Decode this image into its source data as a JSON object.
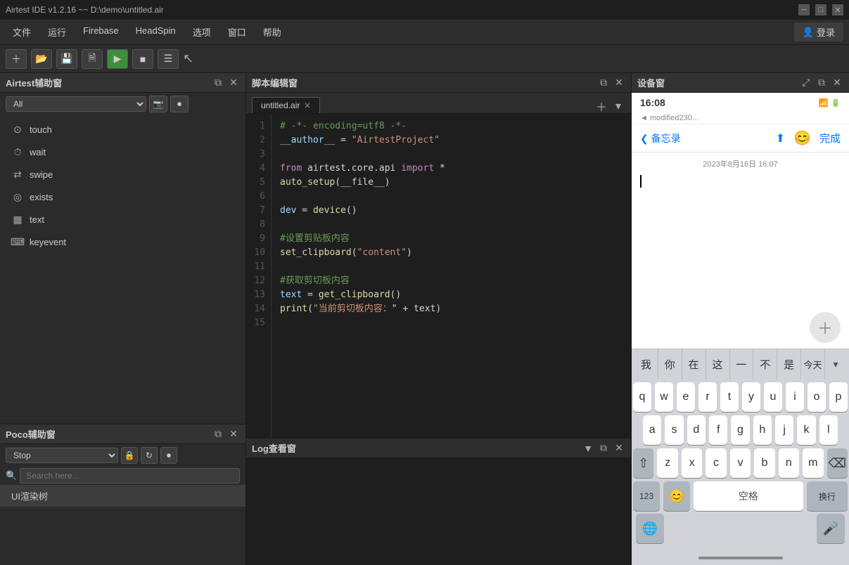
{
  "app": {
    "title": "Airtest IDE v1.2.16 ~~ D:\\demo\\untitled.air",
    "window_controls": [
      "minimize",
      "maximize",
      "close"
    ]
  },
  "menubar": {
    "items": [
      "文件",
      "运行",
      "Firebase",
      "HeadSpin",
      "选项",
      "窗口",
      "帮助"
    ],
    "login": "登录"
  },
  "toolbar": {
    "buttons": [
      "new",
      "open",
      "save",
      "save-as",
      "play",
      "stop",
      "record"
    ]
  },
  "airtest_panel": {
    "title": "Airtest辅助窗",
    "filter": "All",
    "items": [
      {
        "icon": "touch",
        "label": "touch"
      },
      {
        "icon": "wait",
        "label": "wait"
      },
      {
        "icon": "swipe",
        "label": "swipe"
      },
      {
        "icon": "exists",
        "label": "exists"
      },
      {
        "icon": "text",
        "label": "text"
      },
      {
        "icon": "keyevent",
        "label": "keyevent"
      }
    ]
  },
  "poco_panel": {
    "title": "Poco辅助窗",
    "mode": "Stop",
    "search_placeholder": "Search here...",
    "ui_tree": "UI渲染树"
  },
  "script_editor": {
    "title": "脚本编辑窗",
    "tab": "untitled.air",
    "lines": [
      {
        "num": 1,
        "code": "# -*- encoding=utf8 -*-"
      },
      {
        "num": 2,
        "code": "__author__ = \"AirtestProject\""
      },
      {
        "num": 3,
        "code": ""
      },
      {
        "num": 4,
        "code": "from airtest.core.api import *"
      },
      {
        "num": 5,
        "code": "auto_setup(__file__)"
      },
      {
        "num": 6,
        "code": ""
      },
      {
        "num": 7,
        "code": "dev = device()"
      },
      {
        "num": 8,
        "code": ""
      },
      {
        "num": 9,
        "code": "#设置剪贴板内容"
      },
      {
        "num": 10,
        "code": "set_clipboard(\"content\")"
      },
      {
        "num": 11,
        "code": ""
      },
      {
        "num": 12,
        "code": "#获取剪切板内容"
      },
      {
        "num": 13,
        "code": "text = get_clipboard()"
      },
      {
        "num": 14,
        "code": "print(\"当前剪切板内容：\" + text)"
      },
      {
        "num": 15,
        "code": ""
      }
    ]
  },
  "log_panel": {
    "title": "Log查看窗"
  },
  "device_panel": {
    "title": "设备窗",
    "screen": {
      "time": "16:08",
      "modified": "◄ modified230...",
      "nav_back": "〈 备忘录",
      "nav_done": "完成",
      "date_meta": "2023年8月16日 16:07",
      "word_row": [
        "我",
        "你",
        "在",
        "这",
        "一",
        "不",
        "是",
        "今天"
      ],
      "kb_row1": [
        "q",
        "w",
        "e",
        "r",
        "t",
        "y",
        "u",
        "i",
        "o",
        "p"
      ],
      "kb_row2": [
        "a",
        "s",
        "d",
        "f",
        "g",
        "h",
        "j",
        "k",
        "l"
      ],
      "kb_row3": [
        "z",
        "x",
        "c",
        "v",
        "b",
        "n",
        "m"
      ],
      "bottom_row_labels": [
        "123",
        "😊",
        "空格",
        "换行"
      ],
      "home_bar": true
    }
  }
}
